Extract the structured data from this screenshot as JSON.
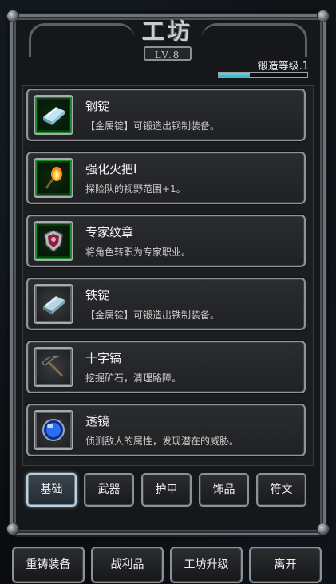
{
  "header": {
    "title": "工坊",
    "level_badge": "LV.8"
  },
  "forge": {
    "level_label": "锻造等级.1",
    "progress_fraction": 0.35,
    "bar_color": "#4cc9da"
  },
  "items": [
    {
      "name": "钢锭",
      "desc": "【金属锭】可锻造出钢制装备。",
      "icon": "steel-ingot-icon",
      "frame": "green"
    },
    {
      "name": "强化火把I",
      "desc": "探险队的视野范围+1。",
      "icon": "torch-icon",
      "frame": "green"
    },
    {
      "name": "专家纹章",
      "desc": "将角色转职为专家职业。",
      "icon": "crest-icon",
      "frame": "green"
    },
    {
      "name": "铁锭",
      "desc": "【金属锭】可锻造出铁制装备。",
      "icon": "iron-ingot-icon",
      "frame": "gray"
    },
    {
      "name": "十字镐",
      "desc": "挖掘矿石，清理路障。",
      "icon": "pickaxe-icon",
      "frame": "gray"
    },
    {
      "name": "透镜",
      "desc": "侦测敌人的属性，发现潜在的威胁。",
      "icon": "lens-icon",
      "frame": "gray"
    }
  ],
  "tabs": [
    {
      "label": "基础",
      "active": true
    },
    {
      "label": "武器",
      "active": false
    },
    {
      "label": "护甲",
      "active": false
    },
    {
      "label": "饰品",
      "active": false
    },
    {
      "label": "符文",
      "active": false
    }
  ],
  "bottom_buttons": [
    {
      "label": "重铸装备"
    },
    {
      "label": "战利品"
    },
    {
      "label": "工坊升级"
    },
    {
      "label": "离开"
    }
  ]
}
